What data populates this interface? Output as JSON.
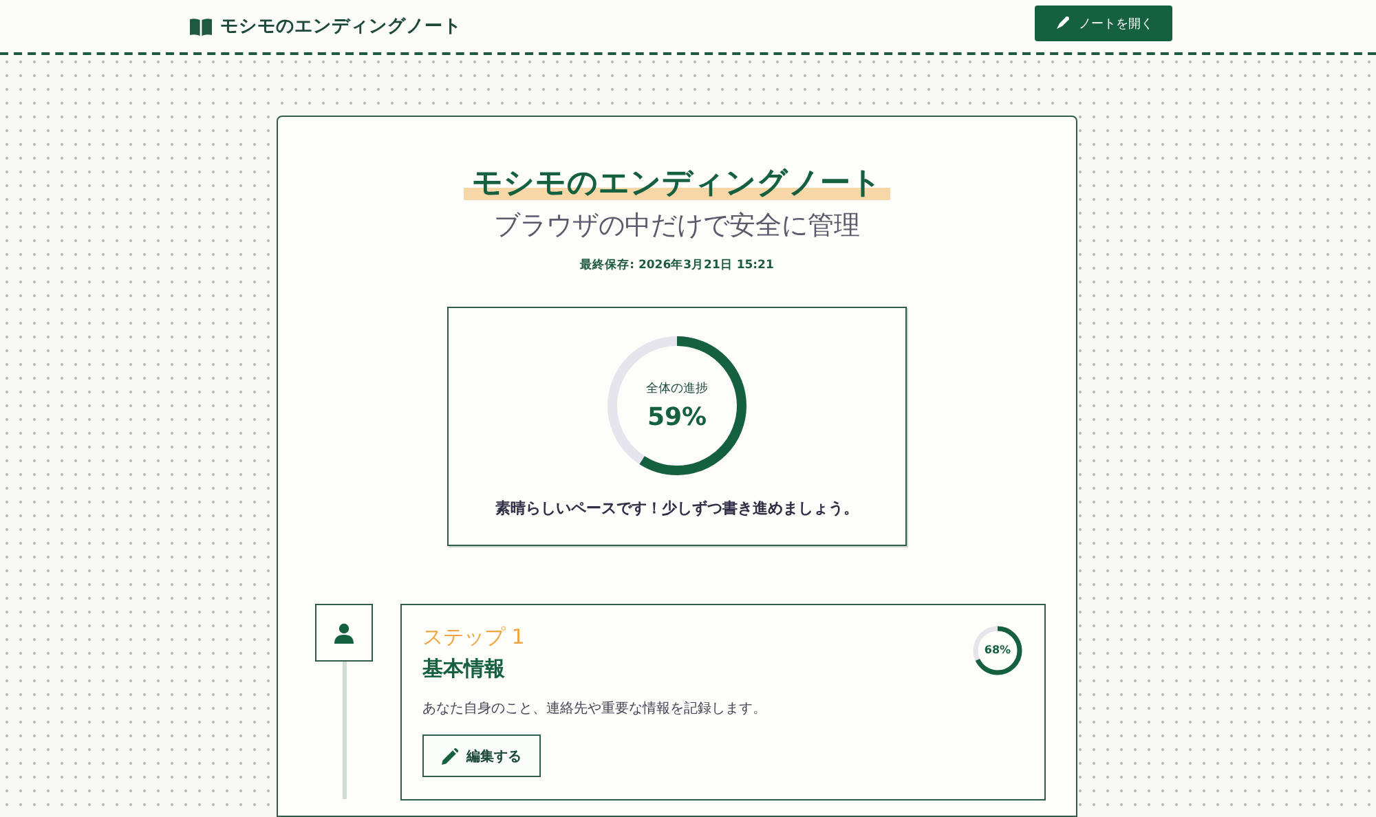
{
  "header": {
    "brand": "モシモのエンディングノート",
    "open_button": "ノートを開く"
  },
  "hero": {
    "title": "モシモのエンディングノート",
    "subtitle": "ブラウザの中だけで安全に管理",
    "last_saved": "最終保存: 2026年3月21日 15:21"
  },
  "overall_progress": {
    "label": "全体の進捗",
    "reading": "59%",
    "level": 0.59,
    "message": "素晴らしいペースです！少しずつ書き進めましょう。"
  },
  "steps": [
    {
      "step": "ステップ 1",
      "title": "基本情報",
      "description": "あなた自身のこと、連絡先や重要な情報を記録します。",
      "reading": "68%",
      "level": 0.68,
      "button": "編集する"
    }
  ]
}
